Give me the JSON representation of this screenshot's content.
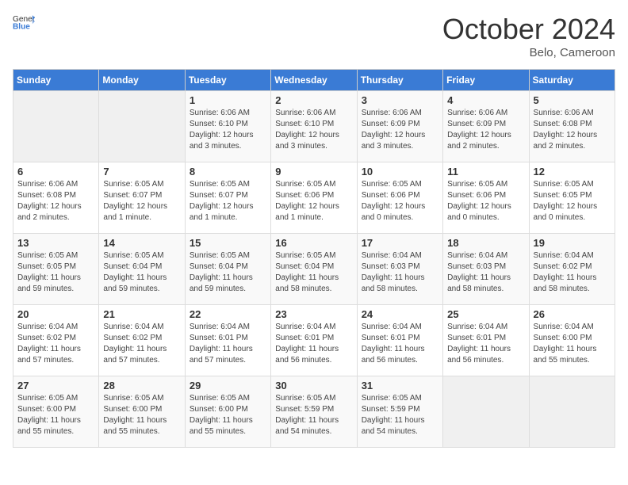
{
  "header": {
    "logo_general": "General",
    "logo_blue": "Blue",
    "month_title": "October 2024",
    "location": "Belo, Cameroon"
  },
  "weekdays": [
    "Sunday",
    "Monday",
    "Tuesday",
    "Wednesday",
    "Thursday",
    "Friday",
    "Saturday"
  ],
  "weeks": [
    [
      {
        "day": "",
        "info": ""
      },
      {
        "day": "",
        "info": ""
      },
      {
        "day": "1",
        "info": "Sunrise: 6:06 AM\nSunset: 6:10 PM\nDaylight: 12 hours and 3 minutes."
      },
      {
        "day": "2",
        "info": "Sunrise: 6:06 AM\nSunset: 6:10 PM\nDaylight: 12 hours and 3 minutes."
      },
      {
        "day": "3",
        "info": "Sunrise: 6:06 AM\nSunset: 6:09 PM\nDaylight: 12 hours and 3 minutes."
      },
      {
        "day": "4",
        "info": "Sunrise: 6:06 AM\nSunset: 6:09 PM\nDaylight: 12 hours and 2 minutes."
      },
      {
        "day": "5",
        "info": "Sunrise: 6:06 AM\nSunset: 6:08 PM\nDaylight: 12 hours and 2 minutes."
      }
    ],
    [
      {
        "day": "6",
        "info": "Sunrise: 6:06 AM\nSunset: 6:08 PM\nDaylight: 12 hours and 2 minutes."
      },
      {
        "day": "7",
        "info": "Sunrise: 6:05 AM\nSunset: 6:07 PM\nDaylight: 12 hours and 1 minute."
      },
      {
        "day": "8",
        "info": "Sunrise: 6:05 AM\nSunset: 6:07 PM\nDaylight: 12 hours and 1 minute."
      },
      {
        "day": "9",
        "info": "Sunrise: 6:05 AM\nSunset: 6:06 PM\nDaylight: 12 hours and 1 minute."
      },
      {
        "day": "10",
        "info": "Sunrise: 6:05 AM\nSunset: 6:06 PM\nDaylight: 12 hours and 0 minutes."
      },
      {
        "day": "11",
        "info": "Sunrise: 6:05 AM\nSunset: 6:06 PM\nDaylight: 12 hours and 0 minutes."
      },
      {
        "day": "12",
        "info": "Sunrise: 6:05 AM\nSunset: 6:05 PM\nDaylight: 12 hours and 0 minutes."
      }
    ],
    [
      {
        "day": "13",
        "info": "Sunrise: 6:05 AM\nSunset: 6:05 PM\nDaylight: 11 hours and 59 minutes."
      },
      {
        "day": "14",
        "info": "Sunrise: 6:05 AM\nSunset: 6:04 PM\nDaylight: 11 hours and 59 minutes."
      },
      {
        "day": "15",
        "info": "Sunrise: 6:05 AM\nSunset: 6:04 PM\nDaylight: 11 hours and 59 minutes."
      },
      {
        "day": "16",
        "info": "Sunrise: 6:05 AM\nSunset: 6:04 PM\nDaylight: 11 hours and 58 minutes."
      },
      {
        "day": "17",
        "info": "Sunrise: 6:04 AM\nSunset: 6:03 PM\nDaylight: 11 hours and 58 minutes."
      },
      {
        "day": "18",
        "info": "Sunrise: 6:04 AM\nSunset: 6:03 PM\nDaylight: 11 hours and 58 minutes."
      },
      {
        "day": "19",
        "info": "Sunrise: 6:04 AM\nSunset: 6:02 PM\nDaylight: 11 hours and 58 minutes."
      }
    ],
    [
      {
        "day": "20",
        "info": "Sunrise: 6:04 AM\nSunset: 6:02 PM\nDaylight: 11 hours and 57 minutes."
      },
      {
        "day": "21",
        "info": "Sunrise: 6:04 AM\nSunset: 6:02 PM\nDaylight: 11 hours and 57 minutes."
      },
      {
        "day": "22",
        "info": "Sunrise: 6:04 AM\nSunset: 6:01 PM\nDaylight: 11 hours and 57 minutes."
      },
      {
        "day": "23",
        "info": "Sunrise: 6:04 AM\nSunset: 6:01 PM\nDaylight: 11 hours and 56 minutes."
      },
      {
        "day": "24",
        "info": "Sunrise: 6:04 AM\nSunset: 6:01 PM\nDaylight: 11 hours and 56 minutes."
      },
      {
        "day": "25",
        "info": "Sunrise: 6:04 AM\nSunset: 6:01 PM\nDaylight: 11 hours and 56 minutes."
      },
      {
        "day": "26",
        "info": "Sunrise: 6:04 AM\nSunset: 6:00 PM\nDaylight: 11 hours and 55 minutes."
      }
    ],
    [
      {
        "day": "27",
        "info": "Sunrise: 6:05 AM\nSunset: 6:00 PM\nDaylight: 11 hours and 55 minutes."
      },
      {
        "day": "28",
        "info": "Sunrise: 6:05 AM\nSunset: 6:00 PM\nDaylight: 11 hours and 55 minutes."
      },
      {
        "day": "29",
        "info": "Sunrise: 6:05 AM\nSunset: 6:00 PM\nDaylight: 11 hours and 55 minutes."
      },
      {
        "day": "30",
        "info": "Sunrise: 6:05 AM\nSunset: 5:59 PM\nDaylight: 11 hours and 54 minutes."
      },
      {
        "day": "31",
        "info": "Sunrise: 6:05 AM\nSunset: 5:59 PM\nDaylight: 11 hours and 54 minutes."
      },
      {
        "day": "",
        "info": ""
      },
      {
        "day": "",
        "info": ""
      }
    ]
  ]
}
